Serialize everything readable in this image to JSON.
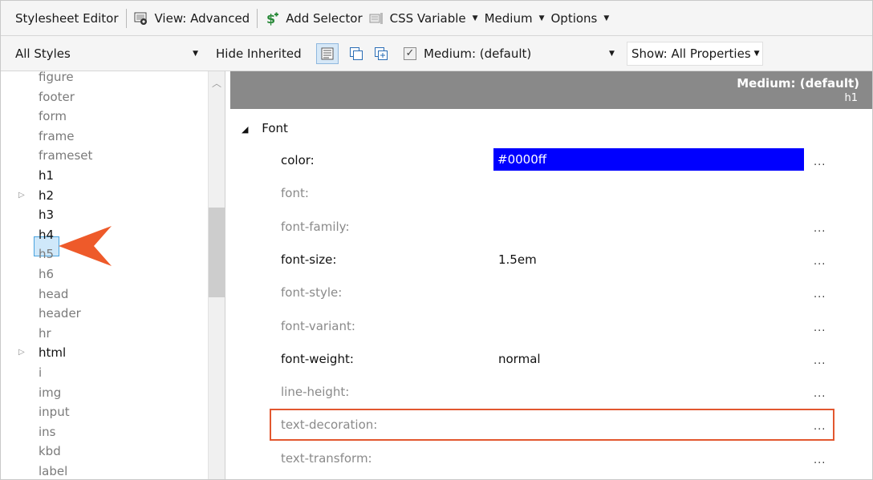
{
  "toolbar": {
    "title": "Stylesheet Editor",
    "view": "View: Advanced",
    "add_selector": "Add Selector",
    "css_variable": "CSS Variable",
    "medium": "Medium",
    "options": "Options",
    "icons": [
      "display-icon",
      "add-selector-icon",
      "css-variable-icon"
    ]
  },
  "filterbar": {
    "styles_dropdown": "All Styles",
    "hide_inherited": "Hide Inherited",
    "medium_checkbox_label": "Medium: (default)",
    "medium_checked": true,
    "show_dropdown": "Show: All Properties",
    "icons": [
      "property-list-icon",
      "copy-icon",
      "add-copy-icon"
    ]
  },
  "selectors": [
    {
      "label": "figure",
      "style": "grey",
      "expandable": false
    },
    {
      "label": "footer",
      "style": "grey",
      "expandable": false
    },
    {
      "label": "form",
      "style": "grey",
      "expandable": false
    },
    {
      "label": "frame",
      "style": "grey",
      "expandable": false
    },
    {
      "label": "frameset",
      "style": "grey",
      "expandable": false
    },
    {
      "label": "h1",
      "style": "dark",
      "expandable": false,
      "selected": true
    },
    {
      "label": "h2",
      "style": "dark",
      "expandable": true
    },
    {
      "label": "h3",
      "style": "dark",
      "expandable": false
    },
    {
      "label": "h4",
      "style": "dark",
      "expandable": false
    },
    {
      "label": "h5",
      "style": "grey",
      "expandable": false
    },
    {
      "label": "h6",
      "style": "grey",
      "expandable": false
    },
    {
      "label": "head",
      "style": "grey",
      "expandable": false
    },
    {
      "label": "header",
      "style": "grey",
      "expandable": false
    },
    {
      "label": "hr",
      "style": "grey",
      "expandable": false
    },
    {
      "label": "html",
      "style": "dark",
      "expandable": true
    },
    {
      "label": "i",
      "style": "grey",
      "expandable": false
    },
    {
      "label": "img",
      "style": "grey",
      "expandable": false
    },
    {
      "label": "input",
      "style": "grey",
      "expandable": false
    },
    {
      "label": "ins",
      "style": "grey",
      "expandable": false
    },
    {
      "label": "kbd",
      "style": "grey",
      "expandable": false
    },
    {
      "label": "label",
      "style": "grey",
      "expandable": false
    }
  ],
  "properties_header": {
    "medium": "Medium: (default)",
    "selector": "h1"
  },
  "section": "Font",
  "properties": [
    {
      "name": "color:",
      "value": "#0000ff",
      "style": "dark",
      "swatch": "#0000ff",
      "more": "..."
    },
    {
      "name": "font:",
      "value": "",
      "style": "grey",
      "more": ""
    },
    {
      "name": "font-family:",
      "value": "",
      "style": "grey",
      "more": "..."
    },
    {
      "name": "font-size:",
      "value": "1.5em",
      "style": "dark",
      "more": "..."
    },
    {
      "name": "font-style:",
      "value": "",
      "style": "grey",
      "more": "..."
    },
    {
      "name": "font-variant:",
      "value": "",
      "style": "grey",
      "more": "..."
    },
    {
      "name": "font-weight:",
      "value": "normal",
      "style": "dark",
      "more": "..."
    },
    {
      "name": "line-height:",
      "value": "",
      "style": "grey",
      "more": "..."
    },
    {
      "name": "text-decoration:",
      "value": "",
      "style": "grey",
      "more": "...",
      "highlighted": true
    },
    {
      "name": "text-transform:",
      "value": "",
      "style": "grey",
      "more": "..."
    }
  ],
  "colors": {
    "highlight_border": "#e2572f",
    "arrow": "#ee5a2a",
    "selection": "#cfe8fa",
    "header_band": "#898989"
  }
}
